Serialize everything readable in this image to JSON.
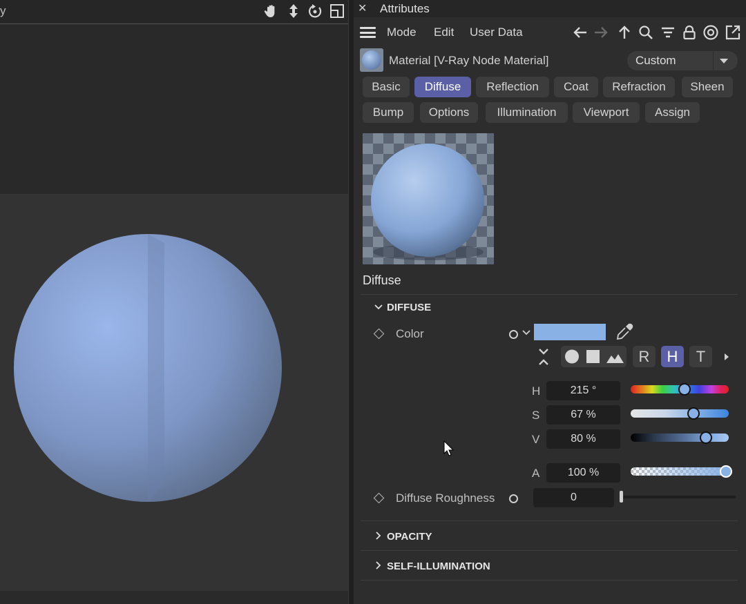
{
  "viewport": {
    "title": "y",
    "icons": [
      "hand-icon",
      "move-icon",
      "rotate-icon",
      "maximize-icon"
    ]
  },
  "attributes": {
    "title": "Attributes",
    "close_glyph": "✕",
    "menu": [
      "Mode",
      "Edit",
      "User Data"
    ],
    "material_label": "Material [V-Ray Node Material]",
    "preset": "Custom",
    "tabs_row1": [
      "Basic",
      "Diffuse",
      "Reflection",
      "Coat",
      "Refraction",
      "Sheen"
    ],
    "tabs_row2": [
      "Bump",
      "Options",
      "Illumination",
      "Viewport",
      "Assign"
    ],
    "active_tab": "Diffuse",
    "preview_label": "Diffuse",
    "sections": {
      "diffuse": "DIFFUSE",
      "opacity": "OPACITY",
      "self_illumination": "SELF-ILLUMINATION"
    },
    "color": {
      "label": "Color",
      "swatch_hex": "#89b1e6",
      "modes": [
        "R",
        "H",
        "T"
      ],
      "active_mode": "H",
      "h_label": "H",
      "h_value": "215 °",
      "h_fraction": 0.58,
      "s_label": "S",
      "s_value": "67 %",
      "s_fraction": 0.67,
      "v_label": "V",
      "v_value": "80 %",
      "v_fraction": 0.8,
      "a_label": "A",
      "a_value": "100 %",
      "a_fraction": 1.0
    },
    "roughness": {
      "label": "Diffuse Roughness",
      "value": "0",
      "fraction": 0.0
    }
  },
  "colors": {
    "accent": "#5a5fa6",
    "panel": "#2d2d2d",
    "sphere": "#8fa9d9"
  }
}
